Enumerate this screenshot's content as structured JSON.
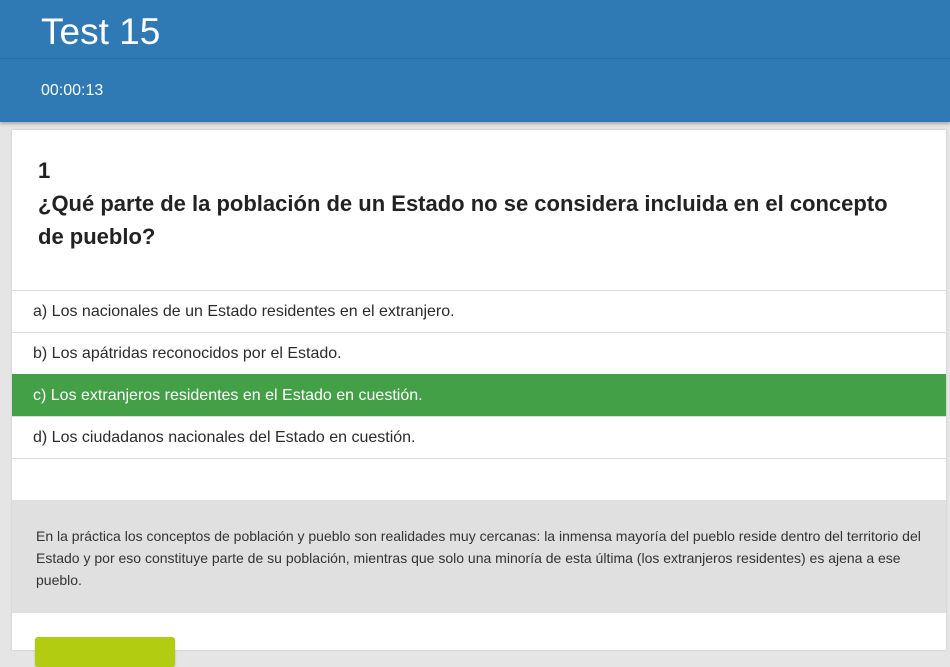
{
  "header": {
    "title": "Test 15",
    "timer": "00:00:13"
  },
  "question": {
    "number": "1",
    "text": "¿Qué parte de la población de un Estado no se considera incluida en el concepto de pueblo?"
  },
  "answers": [
    {
      "label": "a) Los nacionales de un Estado residentes en el extranjero.",
      "correct": false
    },
    {
      "label": "b) Los apátridas reconocidos por el Estado.",
      "correct": false
    },
    {
      "label": "c) Los extranjeros residentes en el Estado en cuestión.",
      "correct": true
    },
    {
      "label": "d) Los ciudadanos nacionales del Estado en cuestión.",
      "correct": false
    }
  ],
  "explanation": "En la práctica los conceptos de población y pueblo son realidades muy cercanas: la inmensa mayoría del pueblo reside dentro del territorio del Estado y por eso constituye parte de su población, mientras que solo una minoría de esta última (los extranjeros residentes) es ajena a ese pueblo.",
  "colors": {
    "header": "#2f79b5",
    "correct": "#43a047",
    "explanation_bg": "#e0e0e0",
    "button": "#b2cc12"
  }
}
